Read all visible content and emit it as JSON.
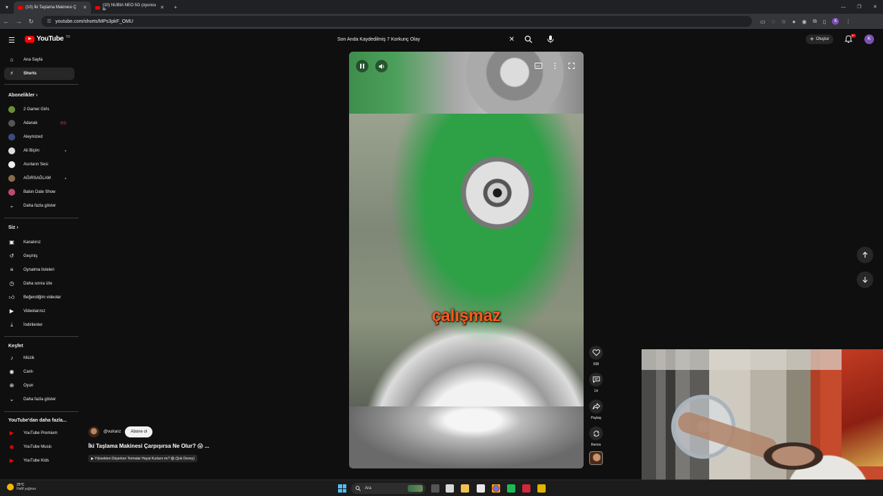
{
  "browser": {
    "tabs": [
      {
        "label": "(10) İki Taşlama Makinesi Ç",
        "active": true
      },
      {
        "label": "(10) NUBIA NEO 5G (oyuncu te",
        "active": false
      }
    ],
    "url": "youtube.com/shorts/MPs3pkF_OMU",
    "profile_initial": "K"
  },
  "masthead": {
    "logo_text": "YouTube",
    "logo_region": "TR",
    "search_value": "Son Anda Kaydedilmiş 7 Korkunç Olay",
    "create_label": "Oluştur",
    "notifications_badge": "9+",
    "avatar_initial": "K"
  },
  "sidebar": {
    "main": [
      {
        "label": "Ana Sayfa",
        "icon": "home-icon"
      },
      {
        "label": "Shorts",
        "icon": "shorts-icon",
        "active": true
      }
    ],
    "subscriptions_header": "Abonelikler",
    "subscriptions": [
      {
        "label": "2 Gamer Girls",
        "color": "#6b8f3a"
      },
      {
        "label": "Adanalı",
        "color": "#555555",
        "live": true
      },
      {
        "label": "Aleymized",
        "color": "#3c4b7a"
      },
      {
        "label": "Ali Biçim",
        "color": "#dddddd",
        "new": true
      },
      {
        "label": "Asırların Sesi",
        "color": "#eeeeee"
      },
      {
        "label": "AĞIRSAĞLAM",
        "color": "#8a6a4a",
        "new": true
      },
      {
        "label": "Balon Date Show",
        "color": "#c04a6a"
      },
      {
        "label": "Daha fazla göster",
        "icon": "chevron-down-icon"
      }
    ],
    "you_header": "Siz",
    "you": [
      {
        "label": "Kanalınız",
        "icon": "channel-icon"
      },
      {
        "label": "Geçmiş",
        "icon": "history-icon"
      },
      {
        "label": "Oynatma listeleri",
        "icon": "playlist-icon"
      },
      {
        "label": "Daha sonra izle",
        "icon": "clock-icon"
      },
      {
        "label": "Beğendiğim videolar",
        "icon": "thumb-up-icon"
      },
      {
        "label": "Videolarınız",
        "icon": "video-icon"
      },
      {
        "label": "İndirilenler",
        "icon": "download-icon"
      }
    ],
    "explore_header": "Keşfet",
    "explore": [
      {
        "label": "Müzik",
        "icon": "music-icon"
      },
      {
        "label": "Canlı",
        "icon": "live-icon"
      },
      {
        "label": "Oyun",
        "icon": "gaming-icon"
      },
      {
        "label": "Daha fazla göster",
        "icon": "chevron-down-icon"
      }
    ],
    "more_header": "YouTube'dan daha fazla...",
    "more": [
      {
        "label": "YouTube Premium"
      },
      {
        "label": "YouTube Music"
      },
      {
        "label": "YouTube Kids"
      }
    ]
  },
  "video": {
    "caption": "çalışmaz",
    "channel": "@vulranz",
    "subscribe_label": "Abone ol",
    "title": "İki Taşlama Makinesi Çarpışırsa Ne Olur? 😱 ...",
    "related": "▶ Yüksekten Düşerken Termalar Hayat Kurtarır mı? 😱 (Şok Deney)",
    "likes": "938",
    "comments": "14",
    "share_label": "Paylaş",
    "remix_label": "Remix"
  },
  "taskbar": {
    "temperature": "25°C",
    "weather": "Hafif yağmur",
    "search_placeholder": "Ara"
  }
}
